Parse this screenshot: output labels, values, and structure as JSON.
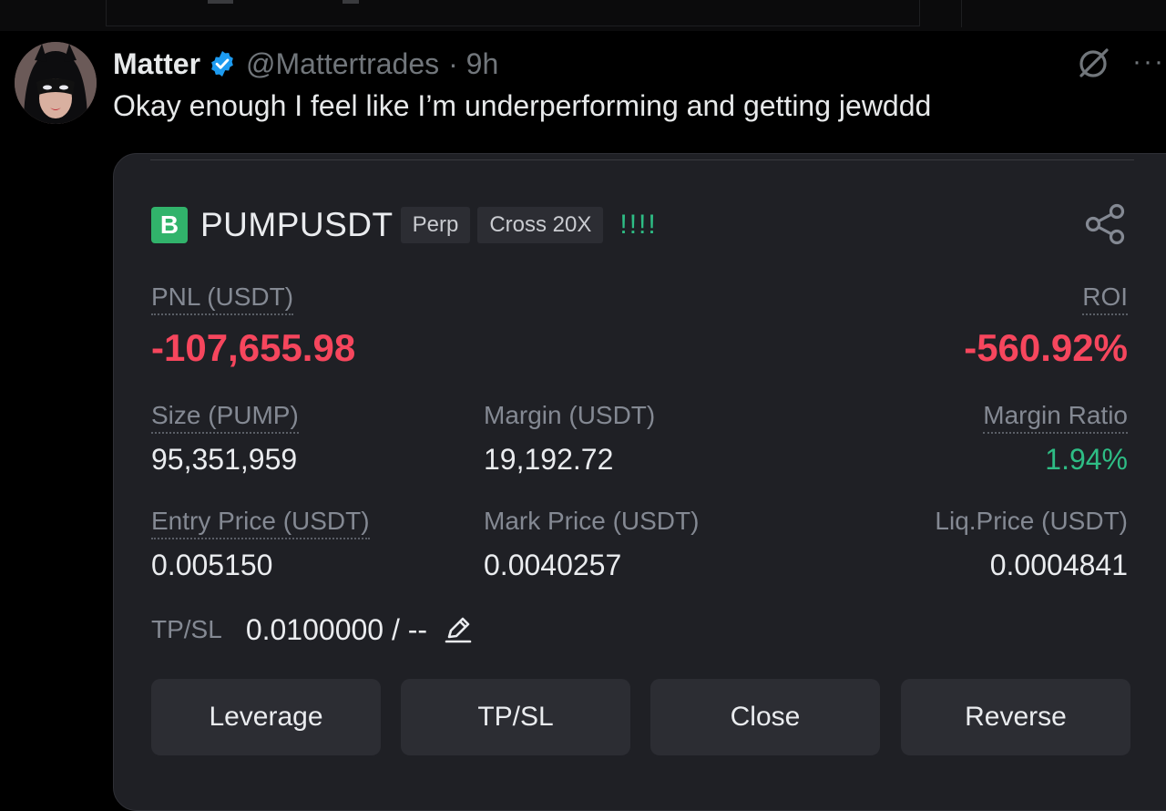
{
  "tweet": {
    "display_name": "Matter",
    "handle": "@Mattertrades",
    "time": "· 9h",
    "text": "Okay enough I feel like I’m underperforming and getting jewddd",
    "more": "···"
  },
  "position": {
    "logo_letter": "B",
    "symbol": "PUMPUSDT",
    "tag_type": "Perp",
    "tag_margin": "Cross 20X",
    "alert": "!!!!",
    "pnl_label": "PNL (USDT)",
    "pnl_value": "-107,655.98",
    "roi_label": "ROI",
    "roi_value": "-560.92%",
    "size_label": "Size (PUMP)",
    "size_value": "95,351,959",
    "margin_label": "Margin (USDT)",
    "margin_value": "19,192.72",
    "margin_ratio_label": "Margin Ratio",
    "margin_ratio_value": "1.94%",
    "entry_label": "Entry Price (USDT)",
    "entry_value": "0.005150",
    "mark_label": "Mark Price (USDT)",
    "mark_value": "0.0040257",
    "liq_label": "Liq.Price (USDT)",
    "liq_value": "0.0004841",
    "tpsl_label": "TP/SL",
    "tpsl_value": "0.0100000 / --"
  },
  "buttons": {
    "leverage": "Leverage",
    "tpsl": "TP/SL",
    "close": "Close",
    "reverse": "Reverse"
  },
  "colors": {
    "loss_red": "#f6465d",
    "gain_green": "#2ebd85",
    "card_bg": "#1f2025",
    "verified_blue": "#1d9bf0"
  },
  "icons": [
    "verified-badge-icon",
    "grok-icon",
    "more-icon",
    "share-icon",
    "edit-icon"
  ]
}
